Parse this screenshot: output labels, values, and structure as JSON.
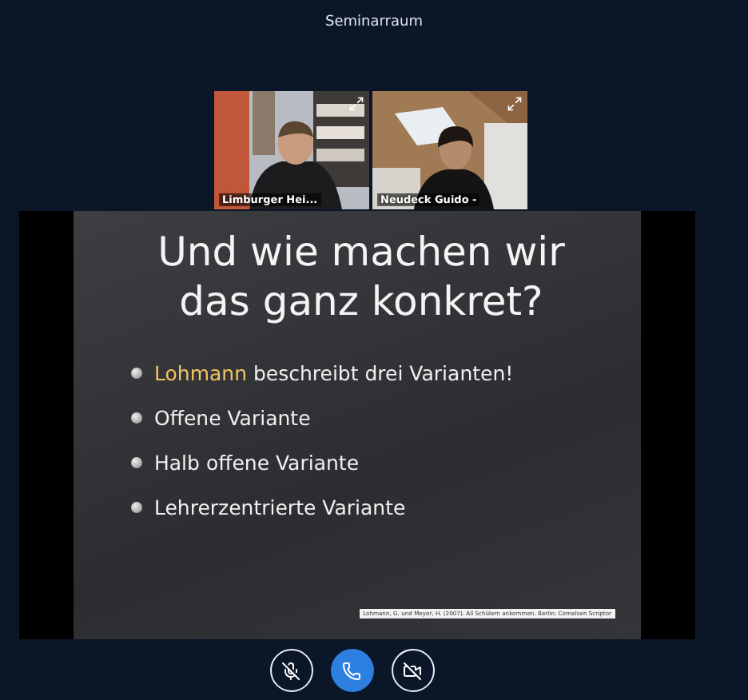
{
  "window": {
    "title": "Seminarraum"
  },
  "participants": [
    {
      "name": "Limburger Hei..."
    },
    {
      "name": "Neudeck Guido -"
    }
  ],
  "slide": {
    "title_lines": [
      "Und wie machen wir",
      "das ganz konkret?"
    ],
    "bullets": [
      {
        "segments": [
          {
            "text": "Lohmann",
            "accent": true
          },
          {
            "text": " beschreibt drei Varianten!",
            "accent": false
          }
        ]
      },
      {
        "segments": [
          {
            "text": "Offene Variante",
            "accent": false
          }
        ]
      },
      {
        "segments": [
          {
            "text": "Halb offene Variante",
            "accent": false
          }
        ]
      },
      {
        "segments": [
          {
            "text": "Lehrerzentrierte Variante",
            "accent": false
          }
        ]
      }
    ],
    "citation": "Lohmann, G. und Meyer, H. (2007). All Schülern ankommen. Berlin: Cornelsen Scriptor"
  },
  "controls": [
    {
      "kind": "mic-off"
    },
    {
      "kind": "call"
    },
    {
      "kind": "video-off"
    }
  ]
}
